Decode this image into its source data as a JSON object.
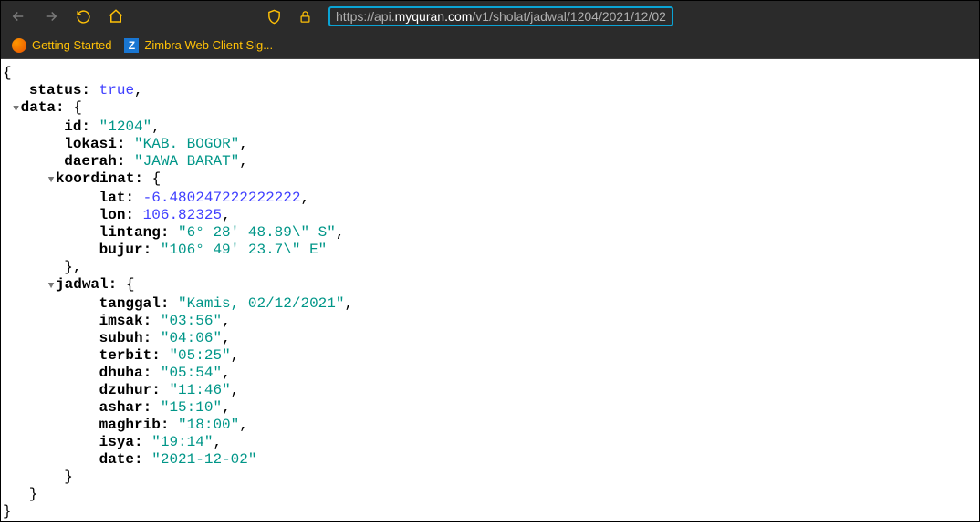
{
  "url": {
    "proto": "https://api.",
    "domain": "myquran.com",
    "path": "/v1/sholat/jadwal/1204/2021/12/02"
  },
  "bookmarks": {
    "getting_started": "Getting Started",
    "zimbra": "Zimbra Web Client Sig...",
    "zimbra_letter": "Z"
  },
  "json": {
    "status_key": "status:",
    "status_val": "true",
    "data_key": "data:",
    "id_key": "id:",
    "id_val": "\"1204\"",
    "lokasi_key": "lokasi:",
    "lokasi_val": "\"KAB. BOGOR\"",
    "daerah_key": "daerah:",
    "daerah_val": "\"JAWA BARAT\"",
    "koordinat_key": "koordinat:",
    "lat_key": "lat:",
    "lat_val": "-6.480247222222222",
    "lon_key": "lon:",
    "lon_val": "106.82325",
    "lintang_key": "lintang:",
    "lintang_val": "\"6° 28' 48.89\\\" S\"",
    "bujur_key": "bujur:",
    "bujur_val": "\"106° 49' 23.7\\\" E\"",
    "jadwal_key": "jadwal:",
    "tanggal_key": "tanggal:",
    "tanggal_val": "\"Kamis, 02/12/2021\"",
    "imsak_key": "imsak:",
    "imsak_val": "\"03:56\"",
    "subuh_key": "subuh:",
    "subuh_val": "\"04:06\"",
    "terbit_key": "terbit:",
    "terbit_val": "\"05:25\"",
    "dhuha_key": "dhuha:",
    "dhuha_val": "\"05:54\"",
    "dzuhur_key": "dzuhur:",
    "dzuhur_val": "\"11:46\"",
    "ashar_key": "ashar:",
    "ashar_val": "\"15:10\"",
    "maghrib_key": "maghrib:",
    "maghrib_val": "\"18:00\"",
    "isya_key": "isya:",
    "isya_val": "\"19:14\"",
    "date_key": "date:",
    "date_val": "\"2021-12-02\""
  }
}
